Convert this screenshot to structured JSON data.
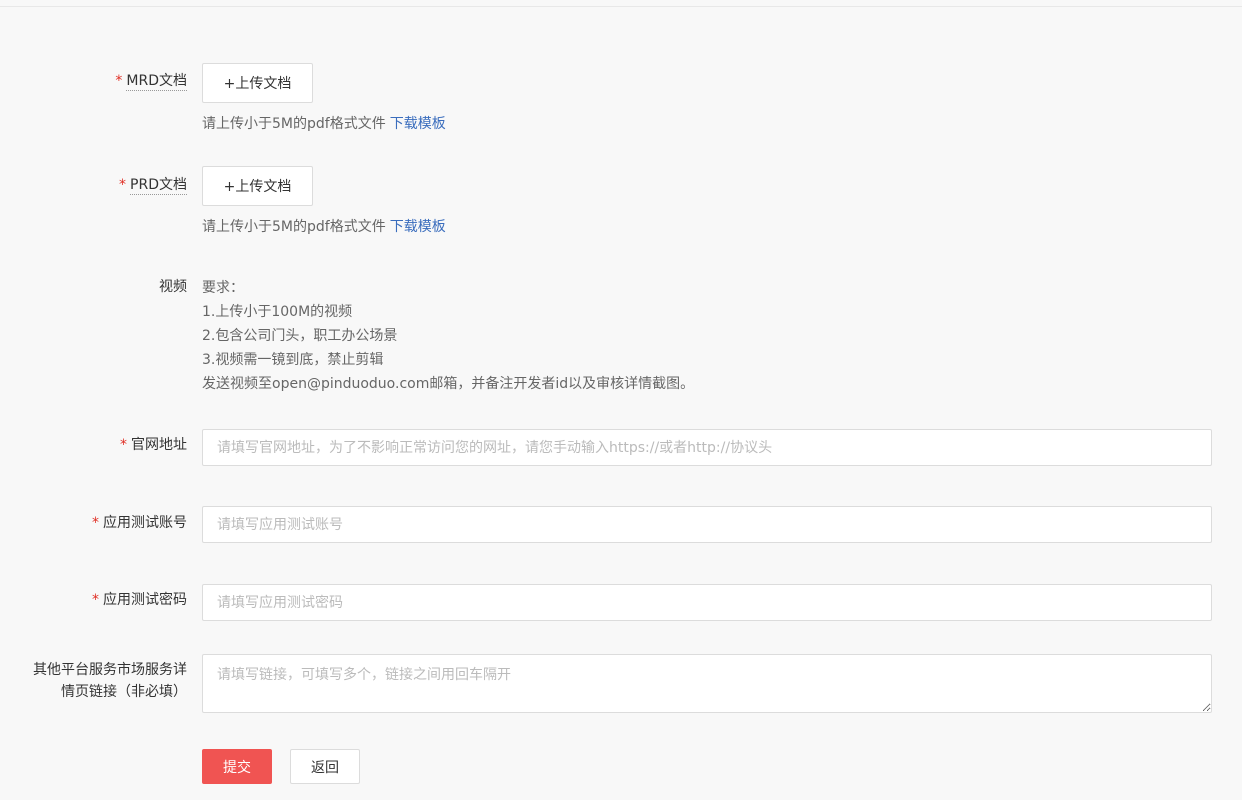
{
  "mrd": {
    "label": "MRD文档",
    "upload_button": "+上传文档",
    "hint": "请上传小于5M的pdf格式文件",
    "template_link": "下载模板"
  },
  "prd": {
    "label": "PRD文档",
    "upload_button": "+上传文档",
    "hint": "请上传小于5M的pdf格式文件",
    "template_link": "下载模板"
  },
  "video": {
    "label": "视频",
    "requirements": [
      "要求：",
      "1.上传小于100M的视频",
      "2.包含公司门头，职工办公场景",
      "3.视频需一镜到底，禁止剪辑",
      "发送视频至open@pinduoduo.com邮箱，并备注开发者id以及审核详情截图。"
    ]
  },
  "website": {
    "label": "官网地址",
    "value": "",
    "placeholder": "请填写官网地址，为了不影响正常访问您的网址，请您手动输入https://或者http://协议头"
  },
  "test_account": {
    "label": "应用测试账号",
    "value": "",
    "placeholder": "请填写应用测试账号"
  },
  "test_password": {
    "label": "应用测试密码",
    "value": "",
    "placeholder": "请填写应用测试密码"
  },
  "other_links": {
    "label_line1": "其他平台服务市场服务详",
    "label_line2": "情页链接（非必填）",
    "value": "",
    "placeholder": "请填写链接，可填写多个，链接之间用回车隔开"
  },
  "actions": {
    "submit": "提交",
    "back": "返回"
  },
  "colors": {
    "required_star": "#e02e24",
    "link": "#3a6dbd",
    "submit_bg": "#f05452"
  }
}
